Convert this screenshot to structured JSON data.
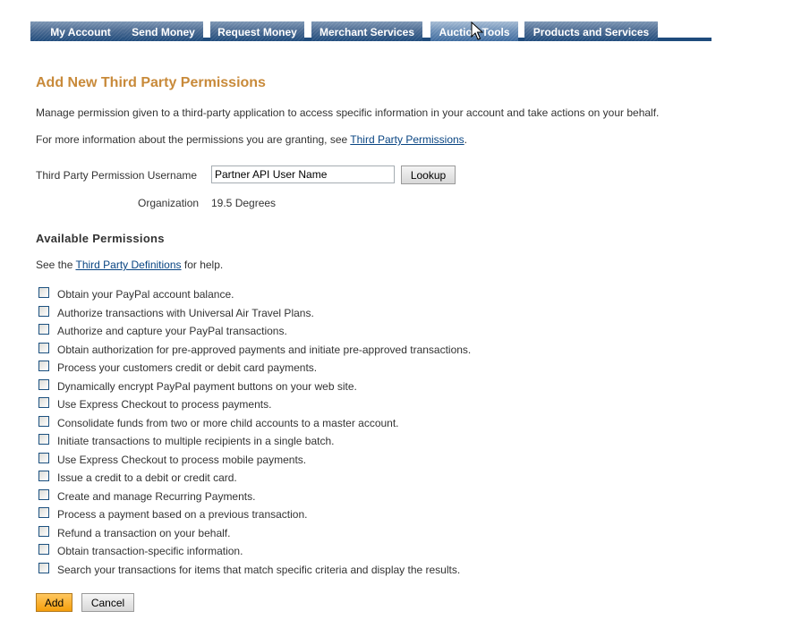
{
  "nav": {
    "tabs": [
      {
        "label": "My Account"
      },
      {
        "label": "Send Money"
      },
      {
        "label": "Request Money"
      },
      {
        "label": "Merchant Services"
      },
      {
        "label": "Auction Tools",
        "state": "hover"
      },
      {
        "label": "Products and Services"
      }
    ]
  },
  "page": {
    "title": "Add New Third Party Permissions",
    "description": "Manage permission given to a third-party application to access specific information in your account and take actions on your behalf.",
    "more_info_prefix": "For more information about the permissions you are granting, see ",
    "more_info_link": "Third Party Permissions",
    "more_info_suffix": "."
  },
  "form": {
    "username_label": "Third Party Permission Username",
    "username_value": "Partner API User Name",
    "lookup_label": "Lookup",
    "organization_label": "Organization",
    "organization_value": "19.5 Degrees"
  },
  "permissions": {
    "heading": "Available Permissions",
    "help_prefix": "See the ",
    "help_link": "Third Party Definitions",
    "help_suffix": " for help.",
    "items": [
      {
        "label": "Obtain your PayPal account balance.",
        "checked": false
      },
      {
        "label": "Authorize transactions with Universal Air Travel Plans.",
        "checked": false
      },
      {
        "label": "Authorize and capture your PayPal transactions.",
        "checked": false
      },
      {
        "label": "Obtain authorization for pre-approved payments and initiate pre-approved transactions.",
        "checked": false
      },
      {
        "label": "Process your customers credit or debit card payments.",
        "checked": false
      },
      {
        "label": "Dynamically encrypt PayPal payment buttons on your web site.",
        "checked": false
      },
      {
        "label": "Use Express Checkout to process payments.",
        "checked": false
      },
      {
        "label": "Consolidate funds from two or more child accounts to a master account.",
        "checked": false
      },
      {
        "label": "Initiate transactions to multiple recipients in a single batch.",
        "checked": false
      },
      {
        "label": "Use Express Checkout to process mobile payments.",
        "checked": false
      },
      {
        "label": "Issue a credit to a debit or credit card.",
        "checked": false
      },
      {
        "label": "Create and manage Recurring Payments.",
        "checked": false
      },
      {
        "label": "Process a payment based on a previous transaction.",
        "checked": false
      },
      {
        "label": "Refund a transaction on your behalf.",
        "checked": false
      },
      {
        "label": "Obtain transaction-specific information.",
        "checked": false
      },
      {
        "label": "Search your transactions for items that match specific criteria and display the results.",
        "checked": false
      }
    ]
  },
  "actions": {
    "add_label": "Add",
    "cancel_label": "Cancel"
  },
  "colors": {
    "title": "#c88a3a",
    "nav_blue": "#1f4b7c",
    "link": "#084482",
    "primary_button": "#f59e0b"
  }
}
